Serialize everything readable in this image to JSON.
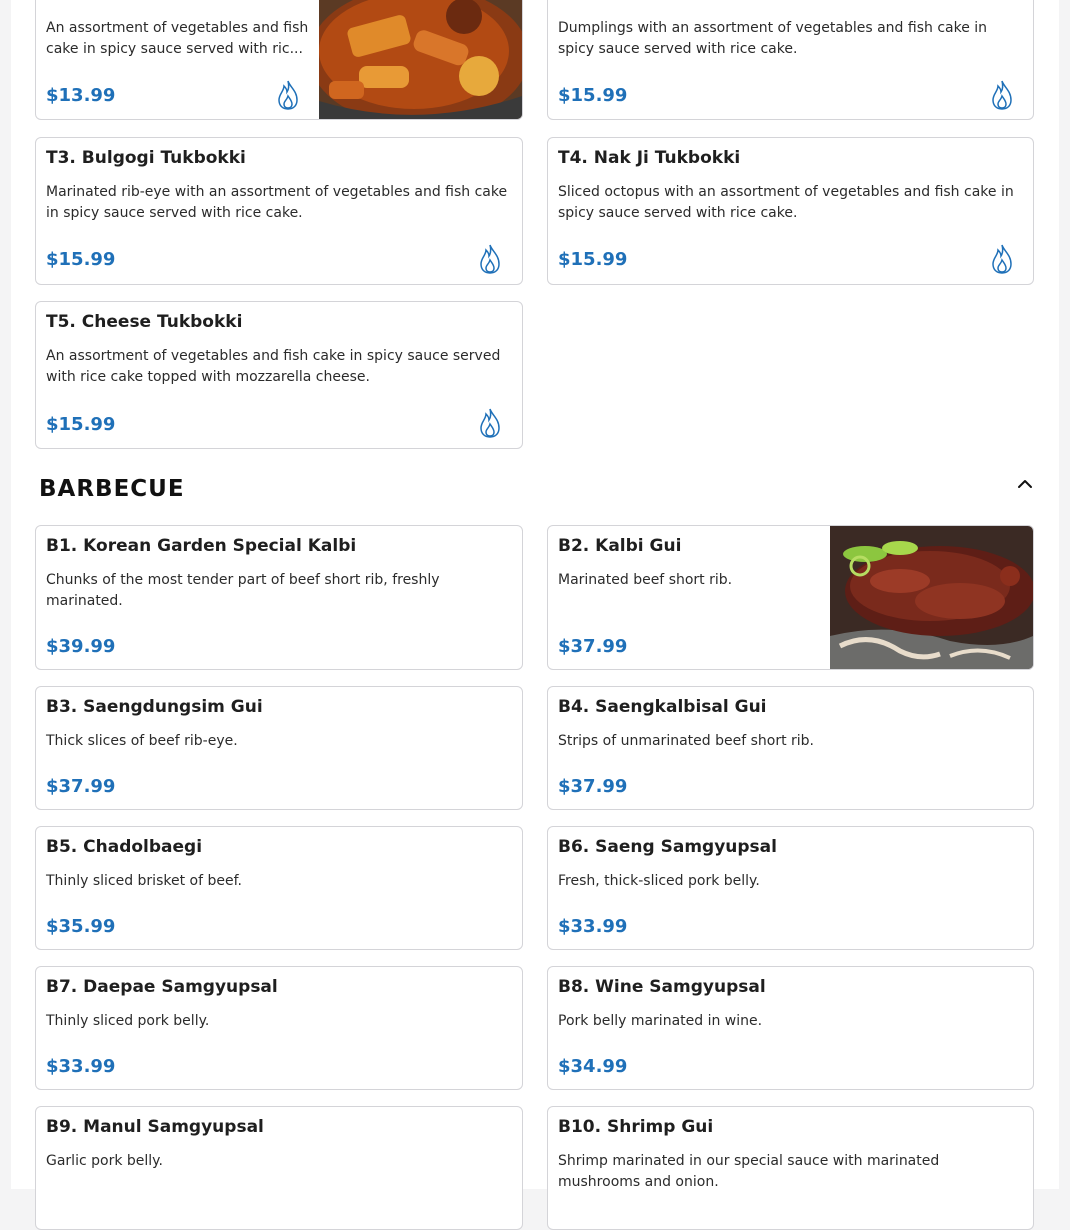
{
  "colors": {
    "price": "#1f70b8",
    "border": "#d4d4d8",
    "spicy": "#1f70b8"
  },
  "top_items": [
    {
      "name": "",
      "description": "An assortment of vegetables and fish cake in spicy sauce served with ric...",
      "price": "$13.99",
      "spicy": true,
      "image": "tteokbokki-photo"
    },
    {
      "name": "",
      "description": "Dumplings with an assortment of vegetables and fish cake in spicy sauce served with rice cake.",
      "price": "$15.99",
      "spicy": true
    }
  ],
  "tukbokki": [
    {
      "name": "T3. Bulgogi Tukbokki",
      "description": "Marinated rib-eye with an assortment of vegetables and fish cake in spicy sauce served with rice cake.",
      "price": "$15.99",
      "spicy": true
    },
    {
      "name": "T4. Nak Ji Tukbokki",
      "description": "Sliced octopus with an assortment of vegetables and fish cake in spicy sauce served with rice cake.",
      "price": "$15.99",
      "spicy": true
    },
    {
      "name": "T5. Cheese Tukbokki",
      "description": "An assortment of vegetables and fish cake in spicy sauce served with rice cake topped with mozzarella cheese.",
      "price": "$15.99",
      "spicy": true
    }
  ],
  "barbecue": {
    "title": "BARBECUE",
    "collapse_icon": "chevron-up-icon",
    "items": [
      {
        "name": "B1. Korean Garden Special Kalbi",
        "description": "Chunks of the most tender part of beef short rib, freshly marinated.",
        "price": "$39.99"
      },
      {
        "name": "B2. Kalbi Gui",
        "description": "Marinated beef short rib.",
        "price": "$37.99",
        "image": "kalbi-photo"
      },
      {
        "name": "B3. Saengdungsim Gui",
        "description": "Thick slices of beef rib-eye.",
        "price": "$37.99"
      },
      {
        "name": "B4. Saengkalbisal Gui",
        "description": "Strips of unmarinated beef short rib.",
        "price": "$37.99"
      },
      {
        "name": "B5. Chadolbaegi",
        "description": "Thinly sliced brisket of beef.",
        "price": "$35.99"
      },
      {
        "name": "B6. Saeng Samgyupsal",
        "description": "Fresh, thick-sliced pork belly.",
        "price": "$33.99"
      },
      {
        "name": "B7. Daepae Samgyupsal",
        "description": "Thinly sliced pork belly.",
        "price": "$33.99"
      },
      {
        "name": "B8. Wine Samgyupsal",
        "description": "Pork belly marinated in wine.",
        "price": "$34.99"
      },
      {
        "name": "B9. Manul Samgyupsal",
        "description": "Garlic pork belly.",
        "price": ""
      },
      {
        "name": "B10. Shrimp Gui",
        "description": "Shrimp marinated in our special sauce with marinated mushrooms and onion.",
        "price": ""
      }
    ]
  }
}
